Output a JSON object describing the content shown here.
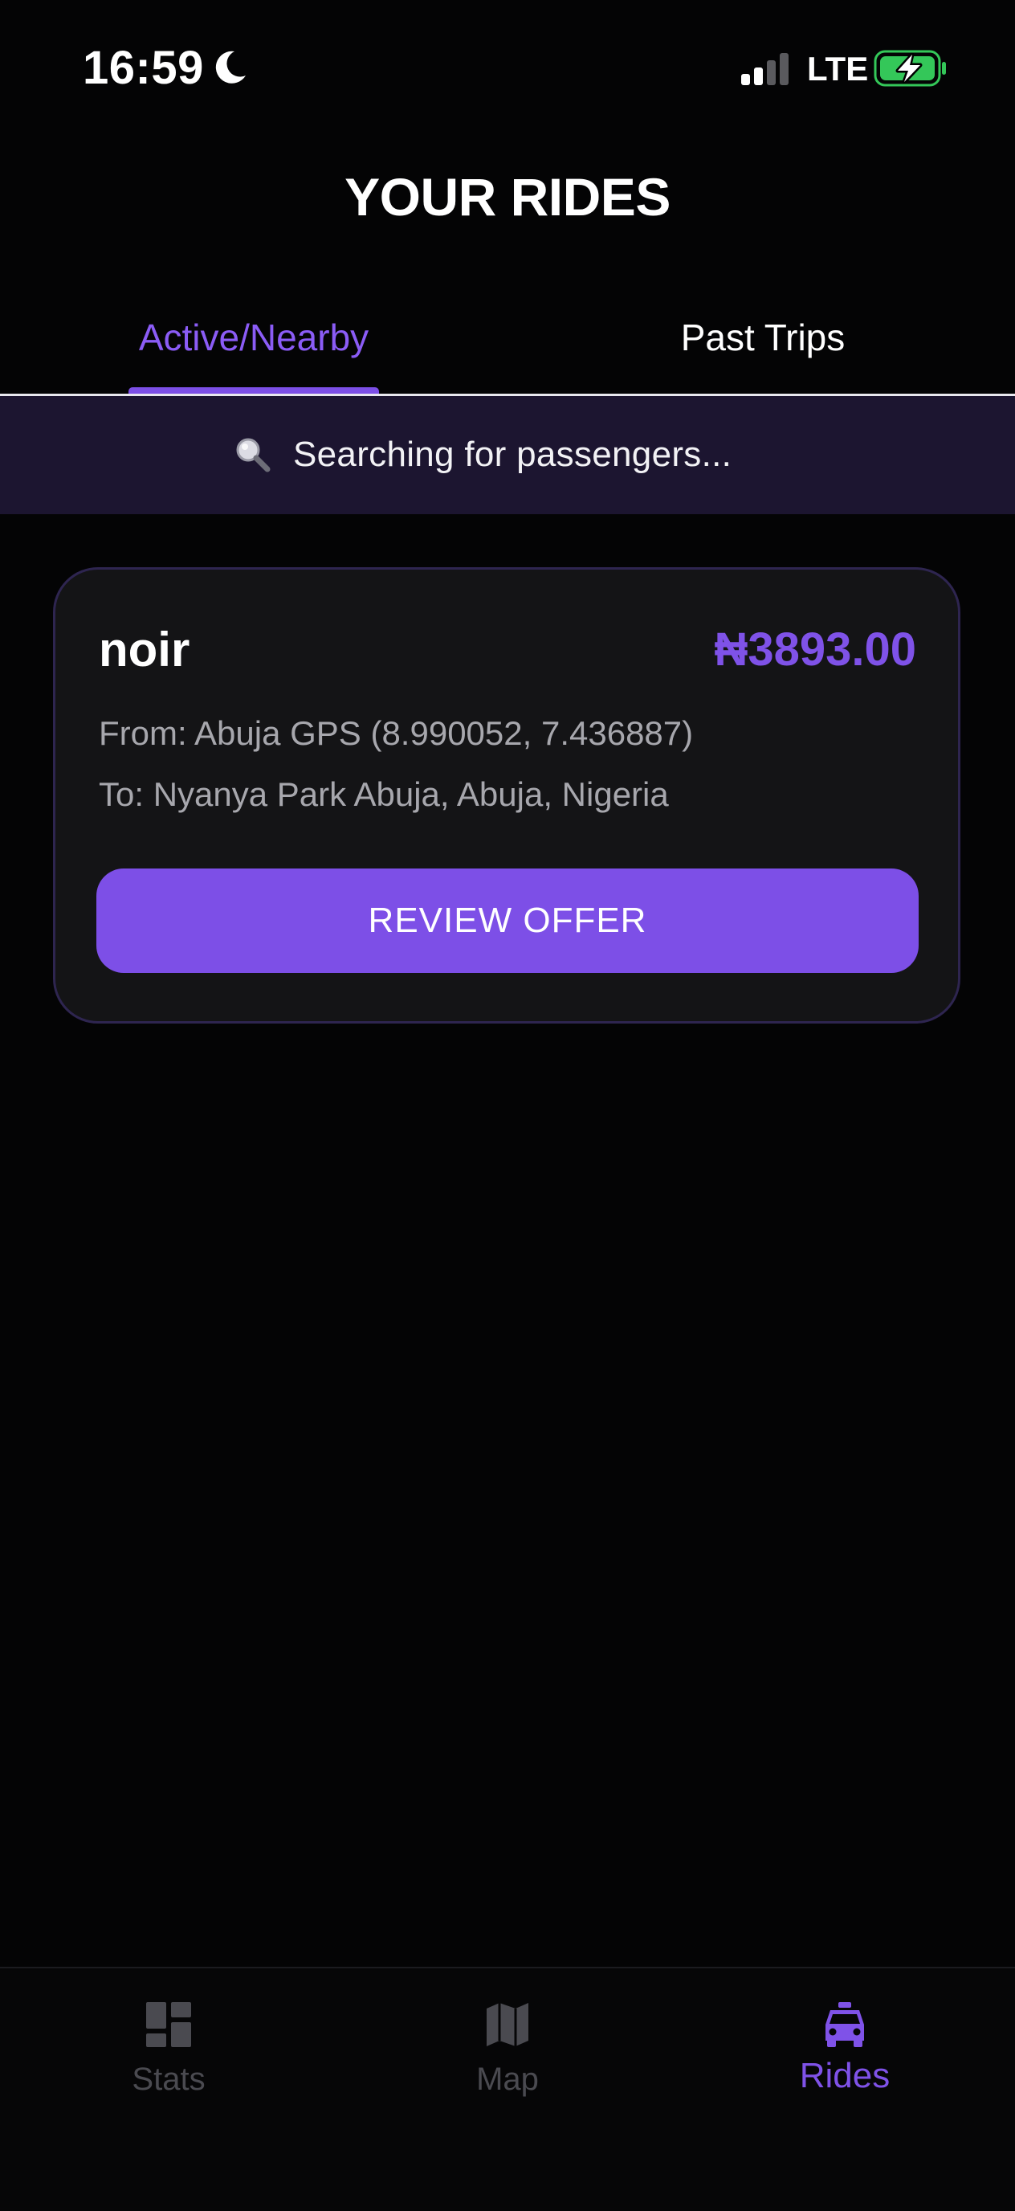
{
  "status_bar": {
    "time": "16:59",
    "network": "LTE",
    "icons": [
      "moon-icon",
      "signal-icon",
      "battery-charging-icon"
    ]
  },
  "header": {
    "title": "YOUR RIDES"
  },
  "tabs": [
    {
      "label": "Active/Nearby",
      "active": true
    },
    {
      "label": "Past Trips",
      "active": false
    }
  ],
  "search_banner": {
    "icon": "magnifying-glass-icon",
    "text": "Searching for passengers..."
  },
  "ride_offer": {
    "rider_name": "noir",
    "price": "₦3893.00",
    "from": "From: Abuja GPS (8.990052, 7.436887)",
    "to": "To: Nyanya Park Abuja, Abuja, Nigeria",
    "action_label": "REVIEW OFFER"
  },
  "bottom_nav": {
    "items": [
      {
        "label": "Stats",
        "icon": "dashboard-grid-icon",
        "active": false
      },
      {
        "label": "Map",
        "icon": "folded-map-icon",
        "active": false
      },
      {
        "label": "Rides",
        "icon": "taxi-icon",
        "active": true
      }
    ]
  },
  "colors": {
    "accent": "#7d4fe7",
    "background": "#040405",
    "card": "#141416",
    "banner": "#1c1530",
    "inactive_nav": "#4a4a50",
    "battery_green": "#34c759"
  }
}
